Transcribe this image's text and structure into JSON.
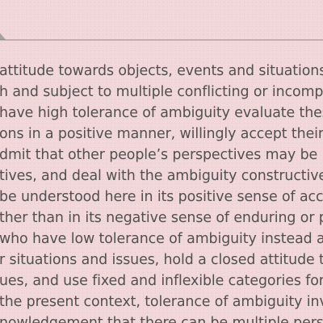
{
  "document": {
    "lines": [
      "attitude towards objects, events and situations",
      "h and subject to multiple conflicting or incomp",
      "have high tolerance of ambiguity evaluate these",
      "ons in a positive manner, willingly accept their in",
      "dmit that other people’s perspectives may be",
      "tives, and deal with the ambiguity constructively.",
      "be understood here in its positive sense of acc",
      "ther than in its negative sense of enduring or p",
      "who have low tolerance of ambiguity instead a",
      "r situations and issues, hold a closed attitude to",
      "ues, and use fixed and inflexible categories for",
      "the present context, tolerance of ambiguity inv",
      "nowledgement that there can be multiple persp"
    ]
  },
  "colors": {
    "background": "#f1d6da",
    "text": "#505050",
    "rule": "#9c8a8d"
  }
}
